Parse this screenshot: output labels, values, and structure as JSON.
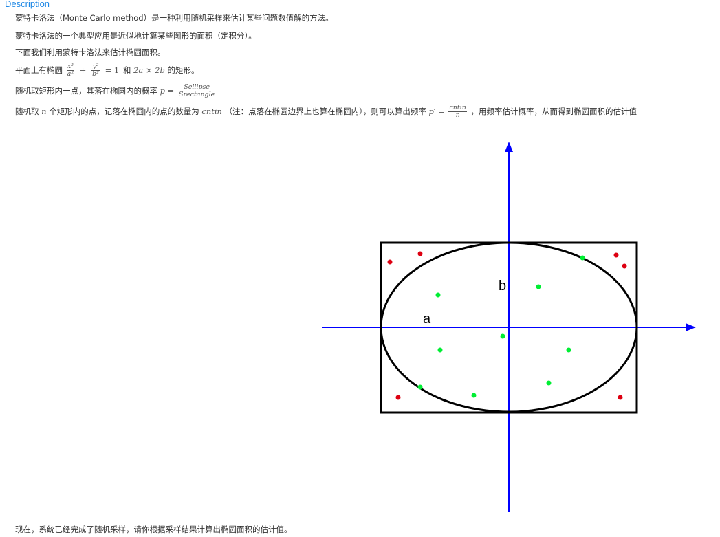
{
  "heading": "Description",
  "p1": "蒙特卡洛法（Monte Carlo method）是一种利用随机采样来估计某些问题数值解的方法。",
  "p2": "蒙特卡洛法的一个典型应用是近似地计算某些图形的面积（定积分）。",
  "p3": "下面我们利用蒙特卡洛法来估计椭圆面积。",
  "p4": {
    "text1": "平面上有椭圆",
    "frac1_num": "x²",
    "frac1_den": "a²",
    "plus": "+",
    "frac2_num": "y²",
    "frac2_den": "b²",
    "eq": "= 1",
    "text2": "和",
    "dims": "2a × 2b",
    "text3": "的矩形。"
  },
  "p5": {
    "text1": "随机取矩形内一点，其落在椭圆内的概率",
    "lhs": "p =",
    "num": "Sellipse",
    "den": "Srectangle"
  },
  "p6": {
    "text1": "随机取",
    "n": "n",
    "text2": "个矩形内的点，记落在椭圆内的点的数量为",
    "cnt": "cntin",
    "text3": "（注：点落在椭圆边界上也算在椭圆内），则可以算出频率",
    "lhs": "p′ =",
    "num": "cntin",
    "den": "n",
    "text4": "，用频率估计概率，从而得到椭圆面积的估计值"
  },
  "figure": {
    "label_a": "a",
    "label_b": "b",
    "axis_color": "#0000ff",
    "shape_color": "#000000",
    "inside_color": "#00ee33",
    "outside_color": "#dd0011"
  },
  "footer": "现在，系统已经完成了随机采样，请你根据采样结果计算出椭圆面积的估计值。"
}
